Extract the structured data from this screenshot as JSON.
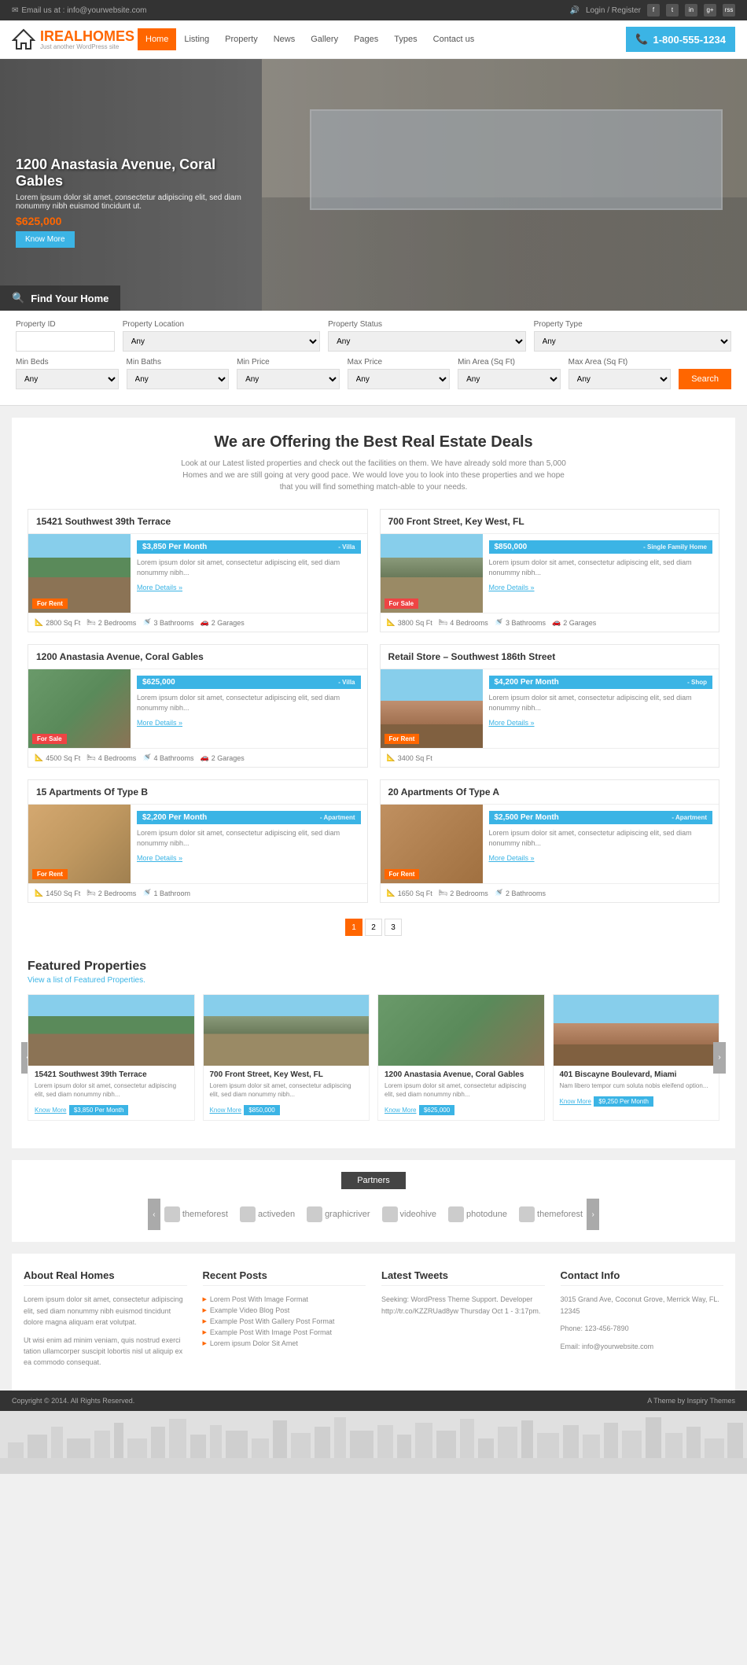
{
  "topbar": {
    "email_label": "Email us at : info@yourwebsite.com",
    "login_label": "Login / Register",
    "phone": "1-800-555-1234"
  },
  "nav": {
    "items": [
      "Home",
      "Listing",
      "Property",
      "News",
      "Gallery",
      "Pages",
      "Types",
      "Contact us"
    ],
    "active": "Home"
  },
  "logo": {
    "brand": "REALHOMES",
    "tagline": "Just another WordPress site"
  },
  "hero": {
    "title": "1200 Anastasia Avenue, Coral Gables",
    "description": "Lorem ipsum dolor sit amet, consectetur adipiscing elit, sed diam nonummy nibh euismod tincidunt ut.",
    "price": "$625,000",
    "cta": "Know More"
  },
  "find_home": {
    "label": "Find Your Home"
  },
  "search": {
    "fields": {
      "id_label": "Property ID",
      "location_label": "Property Location",
      "status_label": "Property Status",
      "type_label": "Property Type",
      "minbeds_label": "Min Beds",
      "minbaths_label": "Min Baths",
      "minprice_label": "Min Price",
      "maxprice_label": "Max Price",
      "minarea_label": "Min Area (Sq Ft)",
      "maxarea_label": "Max Area (Sq Ft)"
    },
    "placeholders": {
      "any": "Any"
    },
    "search_btn": "Search"
  },
  "section": {
    "title": "We are Offering the Best Real Estate Deals",
    "description": "Look at our Latest listed properties and check out the facilities on them. We have already sold more than 5,000 Homes and we are still going at very good pace. We would love you to look into these properties and we hope that you will find something match-able to your needs."
  },
  "properties": [
    {
      "id": 1,
      "address": "15421 Southwest 39th Terrace",
      "price": "$3,850 Per Month",
      "type": "Villa",
      "badge": "For Rent",
      "badge_class": "rent",
      "description": "Lorem ipsum dolor sit amet, consectetur adipiscing elit, sed diam nonummy nibh...",
      "more": "More Details »",
      "sqft": "2800 Sq Ft",
      "beds": "2 Bedrooms",
      "baths": "3 Bathrooms",
      "garages": "2 Garages",
      "img_color": "#7a9ab8"
    },
    {
      "id": 2,
      "address": "700 Front Street, Key West, FL",
      "price": "$850,000",
      "type": "Single Family Home",
      "badge": "For Sale",
      "badge_class": "sale",
      "description": "Lorem ipsum dolor sit amet, consectetur adipiscing elit, sed diam nonummy nibh...",
      "more": "More Details »",
      "sqft": "3800 Sq Ft",
      "beds": "4 Bedrooms",
      "baths": "3 Bathrooms",
      "garages": "2 Garages",
      "img_color": "#9ab87a"
    },
    {
      "id": 3,
      "address": "1200 Anastasia Avenue, Coral Gables",
      "price": "$625,000",
      "type": "Villa",
      "badge": "For Sale",
      "badge_class": "sale",
      "description": "Lorem ipsum dolor sit amet, consectetur adipiscing elit, sed diam nonummy nibh...",
      "more": "More Details »",
      "sqft": "4500 Sq Ft",
      "beds": "4 Bedrooms",
      "baths": "4 Bathrooms",
      "garages": "2 Garages",
      "img_color": "#8aac7a"
    },
    {
      "id": 4,
      "address": "Retail Store – Southwest 186th Street",
      "price": "$4,200 Per Month",
      "type": "Shop",
      "badge": "For Rent",
      "badge_class": "rent",
      "description": "Lorem ipsum dolor sit amet, consectetur adipiscing elit, sed diam nonummy nibh...",
      "more": "More Details »",
      "sqft": "3400 Sq Ft",
      "beds": "",
      "baths": "",
      "garages": "",
      "img_color": "#c0a07a"
    },
    {
      "id": 5,
      "address": "15 Apartments Of Type B",
      "price": "$2,200 Per Month",
      "type": "Apartment",
      "badge": "For Rent",
      "badge_class": "rent",
      "description": "Lorem ipsum dolor sit amet, consectetur adipiscing elit, sed diam nonummy nibh...",
      "more": "More Details »",
      "sqft": "1450 Sq Ft",
      "beds": "2 Bedrooms",
      "baths": "1 Bathroom",
      "garages": "",
      "img_color": "#d4b880"
    },
    {
      "id": 6,
      "address": "20 Apartments Of Type A",
      "price": "$2,500 Per Month",
      "type": "Apartment",
      "badge": "For Rent",
      "badge_class": "rent",
      "description": "Lorem ipsum dolor sit amet, consectetur adipiscing elit, sed diam nonummy nibh...",
      "more": "More Details »",
      "sqft": "1650 Sq Ft",
      "beds": "2 Bedrooms",
      "baths": "2 Bathrooms",
      "garages": "",
      "img_color": "#b89870"
    }
  ],
  "pagination": [
    "1",
    "2",
    "3"
  ],
  "featured": {
    "title": "Featured Properties",
    "subtitle": "View a list of Featured Properties.",
    "items": [
      {
        "address": "15421 Southwest 39th Terrace",
        "description": "Lorem ipsum dolor sit amet, consectetur adipiscing elit, sed diam nonummy nibh...",
        "link": "Know More",
        "price": "$3,850 Per Month",
        "img_color": "#7a9ab8"
      },
      {
        "address": "700 Front Street, Key West, FL",
        "description": "Lorem ipsum dolor sit amet, consectetur adipiscing elit, sed diam nonummy nibh...",
        "link": "Know More",
        "price": "$850,000",
        "img_color": "#9ab87a"
      },
      {
        "address": "1200 Anastasia Avenue, Coral Gables",
        "description": "Lorem ipsum dolor sit amet, consectetur adipiscing elit, sed diam nonummy nibh...",
        "link": "Know More",
        "price": "$625,000",
        "img_color": "#8aac7a"
      },
      {
        "address": "401 Biscayne Boulevard, Miami",
        "description": "Nam libero tempor cum soluta nobis eleifend option...",
        "link": "Know More",
        "price": "$9,250 Per Month",
        "img_color": "#b8a07a"
      }
    ]
  },
  "partners": {
    "title": "Partners",
    "items": [
      "themeforest",
      "activeden",
      "graphicriver",
      "videohive",
      "photodune",
      "themeforest"
    ]
  },
  "footer": {
    "about": {
      "title": "About Real Homes",
      "text1": "Lorem ipsum dolor sit amet, consectetur adipiscing elit, sed diam nonummy nibh euismod tincidunt dolore magna aliquam erat volutpat.",
      "text2": "Ut wisi enim ad minim veniam, quis nostrud exerci tation ullamcorper suscipit lobortis nisl ut aliquip ex ea commodo consequat."
    },
    "posts": {
      "title": "Recent Posts",
      "items": [
        "Lorem Post With Image Format",
        "Example Video Blog Post",
        "Example Post With Gallery Post Format",
        "Example Post With Image Post Format",
        "Lorem ipsum Dolor Sit Amet"
      ]
    },
    "tweets": {
      "title": "Latest Tweets",
      "tweet": "Seeking: WordPress Theme Support. Developer http://tr.co/KZZRUad8yw Thursday Oct 1 - 3:17pm."
    },
    "contact": {
      "title": "Contact Info",
      "address": "3015 Grand Ave, Coconut Grove, Merrick Way, FL. 12345",
      "phone": "Phone: 123-456-7890",
      "email": "Email: info@yourwebsite.com"
    },
    "copyright": "Copyright © 2014. All Rights Reserved.",
    "theme": "A Theme by Inspiry Themes"
  }
}
